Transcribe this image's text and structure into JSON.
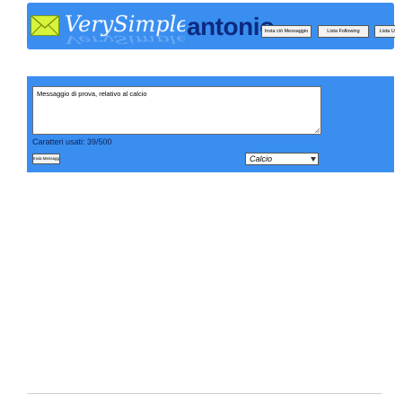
{
  "header": {
    "logo_text": "VerySimple",
    "username": "antonio",
    "nav": [
      {
        "label": "Invia ciò Messaggio"
      },
      {
        "label": "Lista Following"
      },
      {
        "label": "Lista Utenti"
      }
    ],
    "icons": {
      "logo": "mail-envelope-icon"
    }
  },
  "compose": {
    "message_value": "Messaggio di prova, relativo al calcio",
    "char_counter": "Caratteri usati: 39/500",
    "send_label": "Invia Messaggio",
    "category_selected": "Calcio"
  },
  "colors": {
    "accent": "#3a8ef0",
    "title_text": "#0b2a80",
    "page_bg": "#ffffff"
  }
}
